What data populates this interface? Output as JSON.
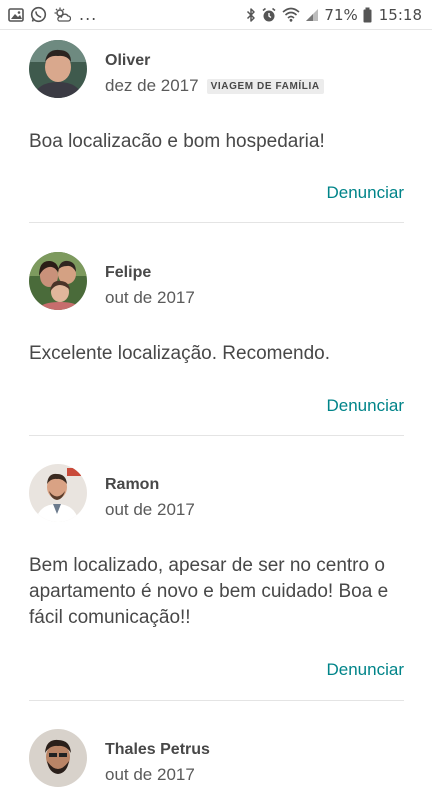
{
  "status_bar": {
    "icons": [
      "image-icon",
      "whatsapp-icon",
      "weather-icon"
    ],
    "dots": "...",
    "battery_percent": "71%",
    "time": "15:18"
  },
  "reviews": [
    {
      "name": "Oliver",
      "date": "dez de 2017",
      "badge": "VIAGEM DE FAMÍLIA",
      "text": "Boa localizacão e bom hospedaria!",
      "report_label": "Denunciar"
    },
    {
      "name": "Felipe",
      "date": "out de 2017",
      "text": "Excelente localização. Recomendo.",
      "report_label": "Denunciar"
    },
    {
      "name": "Ramon",
      "date": "out de 2017",
      "text": "Bem localizado, apesar de ser no centro o apartamento é novo e bem cuidado! Boa e fácil comunicação!!",
      "report_label": "Denunciar"
    },
    {
      "name": "Thales Petrus",
      "date": "out de 2017"
    }
  ],
  "colors": {
    "link": "#008489",
    "text": "#484848",
    "divider": "#e4e4e4"
  }
}
